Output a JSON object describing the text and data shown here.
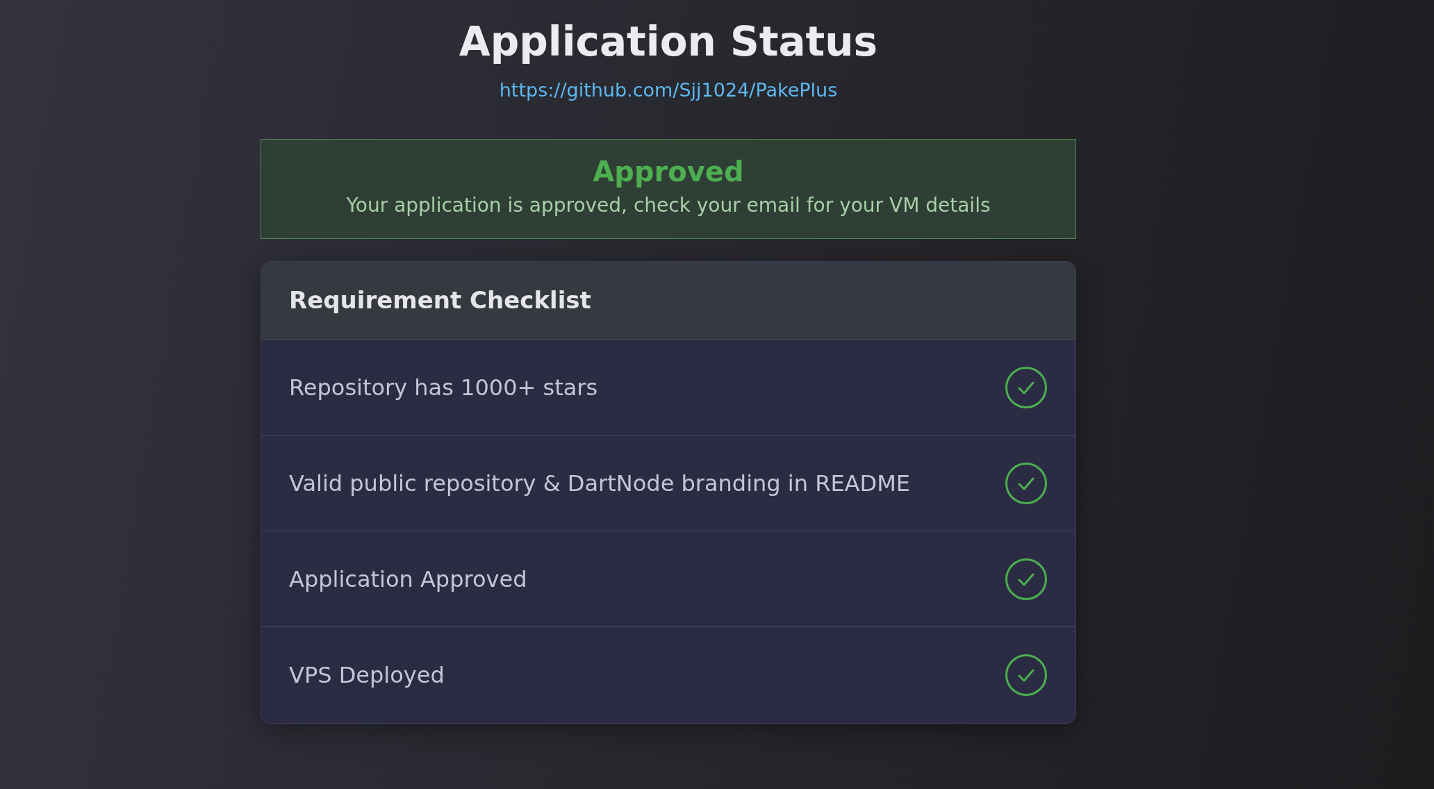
{
  "page": {
    "title": "Application Status",
    "link": "https://github.com/Sjj1024/PakePlus"
  },
  "status_alert": {
    "approved": true,
    "title": "Approved",
    "message": "Your application is approved, check your email for your VM details"
  },
  "checklist": {
    "title": "Requirement Checklist",
    "items": [
      {
        "label": "Repository has 1000+ stars",
        "checked": true
      },
      {
        "label": "Valid public repository & DartNode branding in README",
        "checked": true
      },
      {
        "label": "Application Approved",
        "checked": true
      },
      {
        "label": "VPS Deployed",
        "checked": true
      }
    ]
  }
}
